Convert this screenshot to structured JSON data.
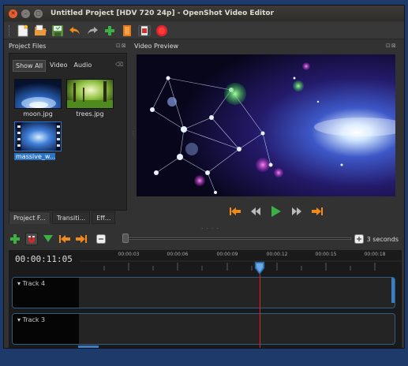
{
  "window": {
    "title": "Untitled Project [HDV 720 24p] - OpenShot Video Editor",
    "close_glyph": "✕",
    "minimize_glyph": "–",
    "maximize_glyph": "▢"
  },
  "toolbar": {
    "items": [
      "new-project-icon",
      "open-project-icon",
      "save-project-icon",
      "undo-icon",
      "redo-icon",
      "import-files-icon",
      "choose-profile-icon",
      "export-video-icon",
      "fullscreen-icon"
    ]
  },
  "project_files": {
    "title": "Project Files",
    "dock_controls": "⊡⊠",
    "filters": [
      "Show All",
      "Video",
      "Audio"
    ],
    "search_glyph": "⌫",
    "files": [
      {
        "name": "moon.jpg"
      },
      {
        "name": "trees.jpg"
      },
      {
        "name": "massive_w..."
      }
    ]
  },
  "bottom_tabs": [
    "Project F...",
    "Transiti...",
    "Eff..."
  ],
  "video_preview": {
    "title": "Video Preview",
    "dock_controls": "⊡⊠"
  },
  "timeline": {
    "zoom_label": "3 seconds",
    "timecode": "00:00:11:05",
    "ruler_ticks": [
      "00:00:03",
      "00:00:06",
      "00:00:09",
      "00:00:12",
      "00:00:15",
      "00:00:18"
    ],
    "tracks": [
      "Track 4",
      "Track 3"
    ]
  },
  "colors": {
    "accent": "#2a73c7",
    "playhead": "#e0242a",
    "track_border": "#2e5d8a",
    "add_green": "#3cb043",
    "jump_orange": "#f08a1c"
  }
}
